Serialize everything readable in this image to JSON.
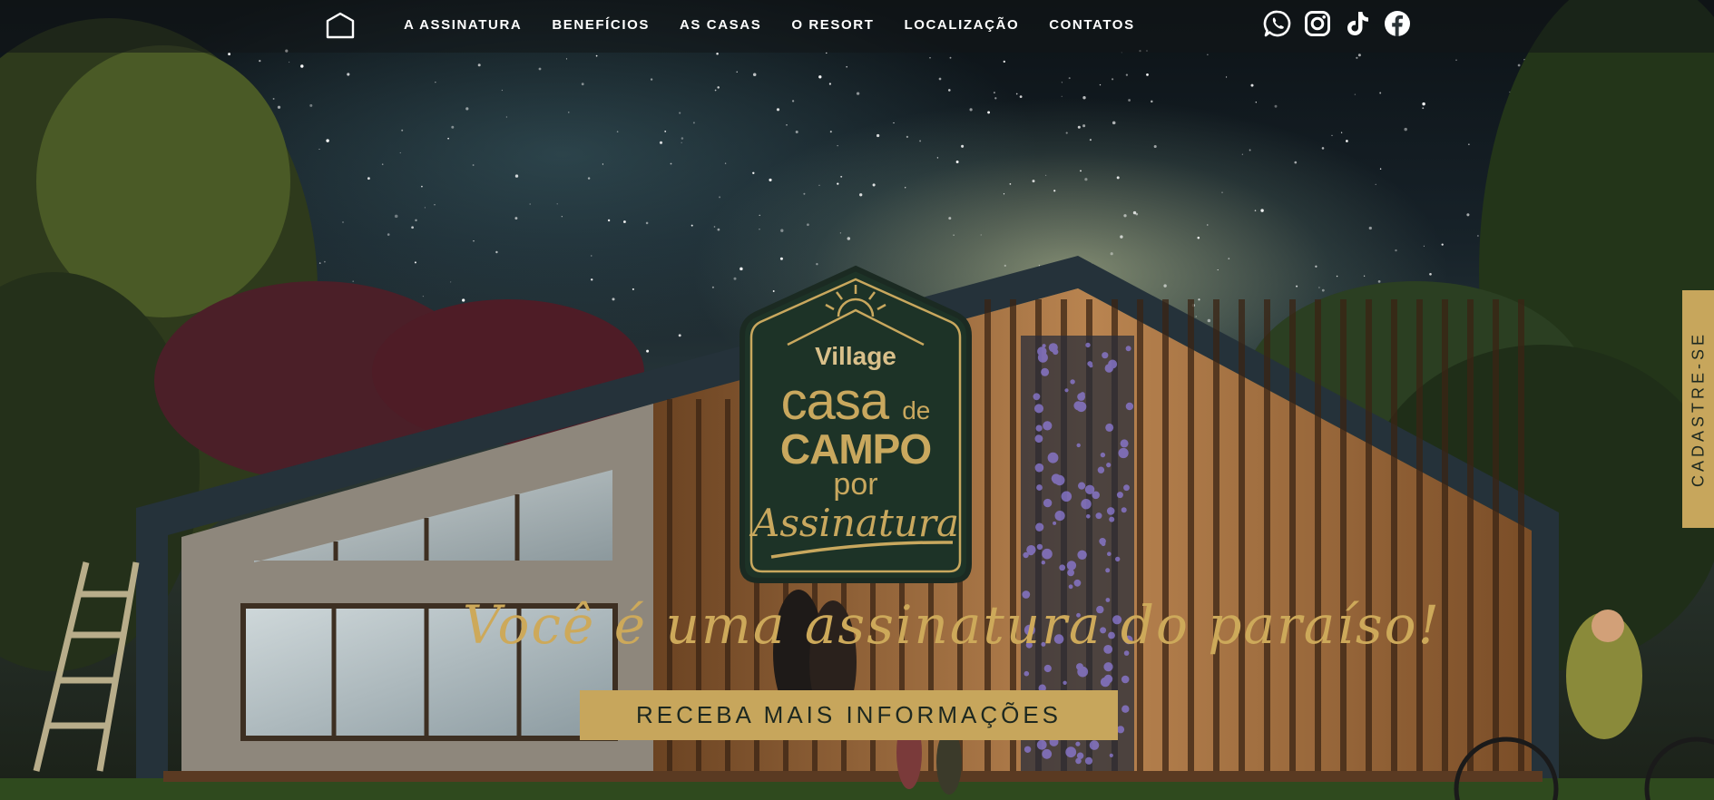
{
  "nav": {
    "home_icon": "house-outline-icon",
    "links": [
      {
        "label": "A ASSINATURA"
      },
      {
        "label": "BENEFÍCIOS"
      },
      {
        "label": "AS CASAS"
      },
      {
        "label": "O RESORT"
      },
      {
        "label": "LOCALIZAÇÃO"
      },
      {
        "label": "CONTATOS"
      }
    ],
    "social_icons": [
      "whatsapp-icon",
      "instagram-icon",
      "tiktok-icon",
      "facebook-icon"
    ]
  },
  "logo": {
    "line1": "Village",
    "line2": "casa",
    "line2_suffix": "de",
    "line3": "CAMPO",
    "line4": "por",
    "line5": "Assinatura",
    "icon": "sun-over-roof-icon"
  },
  "hero": {
    "tagline": "Você é uma assinatura do paraíso!",
    "cta_label": "RECEBA MAIS INFORMAÇÕES"
  },
  "side_tab": {
    "label": "CADASTRE-SE"
  },
  "colors": {
    "gold": "#c7a65c",
    "badge_green": "#1d3327",
    "nav_bg": "#121618",
    "text_dark": "#1d2820"
  }
}
